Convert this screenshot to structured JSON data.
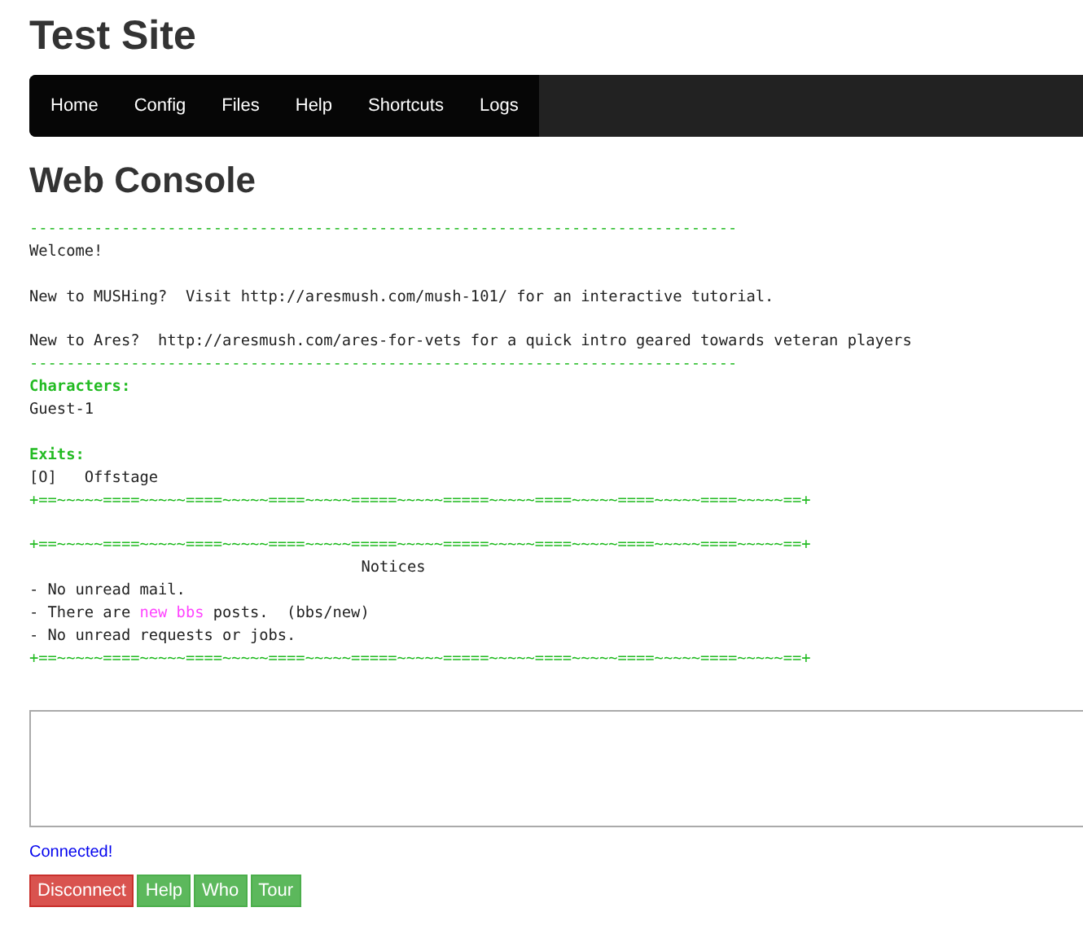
{
  "site_title": "Test Site",
  "nav": [
    "Home",
    "Config",
    "Files",
    "Help",
    "Shortcuts",
    "Logs"
  ],
  "page_title": "Web Console",
  "console": [
    {
      "kind": "rule",
      "text": "-----------------------------------------------------------------------------"
    },
    {
      "kind": "text",
      "text": "Welcome!"
    },
    {
      "kind": "blank"
    },
    {
      "kind": "text",
      "text": "New to MUSHing?  Visit http://aresmush.com/mush-101/ for an interactive tutorial."
    },
    {
      "kind": "blank"
    },
    {
      "kind": "text",
      "text": "New to Ares?  http://aresmush.com/ares-for-vets for a quick intro geared towards veteran players"
    },
    {
      "kind": "rule",
      "text": "-----------------------------------------------------------------------------"
    },
    {
      "kind": "heading",
      "text": "Characters:"
    },
    {
      "kind": "text",
      "text": "Guest-1"
    },
    {
      "kind": "blank"
    },
    {
      "kind": "heading",
      "text": "Exits:"
    },
    {
      "kind": "text",
      "text": "[O]   Offstage"
    },
    {
      "kind": "rule",
      "text": "+==~~~~~====~~~~~====~~~~~====~~~~~=====~~~~~=====~~~~~====~~~~~====~~~~~====~~~~~==+"
    },
    {
      "kind": "blank"
    },
    {
      "kind": "rule",
      "text": "+==~~~~~====~~~~~====~~~~~====~~~~~=====~~~~~=====~~~~~====~~~~~====~~~~~====~~~~~==+"
    },
    {
      "kind": "center",
      "text": "Notices"
    },
    {
      "kind": "text",
      "text": "- No unread mail."
    },
    {
      "kind": "parts",
      "parts": [
        {
          "text": "- There are "
        },
        {
          "text": "new bbs",
          "color": "#ff44ff"
        },
        {
          "text": " posts.  (bbs/new)"
        }
      ]
    },
    {
      "kind": "text",
      "text": "- No unread requests or jobs."
    },
    {
      "kind": "rule",
      "text": "+==~~~~~====~~~~~====~~~~~====~~~~~=====~~~~~=====~~~~~====~~~~~====~~~~~====~~~~~==+"
    }
  ],
  "status": "Connected!",
  "buttons": [
    {
      "label": "Disconnect",
      "kind": "danger"
    },
    {
      "label": "Help",
      "kind": "success"
    },
    {
      "label": "Who",
      "kind": "success"
    },
    {
      "label": "Tour",
      "kind": "success"
    }
  ]
}
